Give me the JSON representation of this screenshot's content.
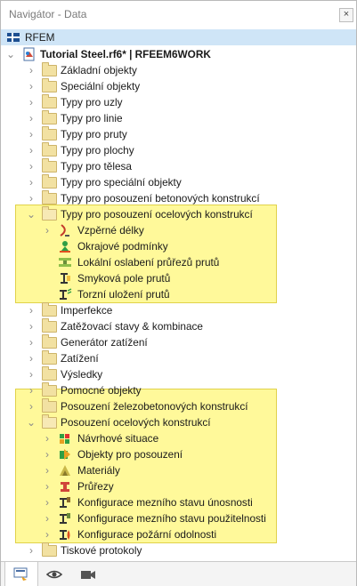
{
  "window": {
    "title": "Navigátor - Data",
    "close_label": "×"
  },
  "tree": {
    "root": "RFEM",
    "project": "Tutorial Steel.rf6* | RFEEM6WORK",
    "items": [
      "Základní objekty",
      "Speciální objekty",
      "Typy pro uzly",
      "Typy pro linie",
      "Typy pro pruty",
      "Typy pro plochy",
      "Typy pro tělesa",
      "Typy pro speciální objekty",
      "Typy pro posouzení betonových konstrukcí"
    ],
    "steel_types": {
      "label": "Typy pro posouzení ocelových konstrukcí",
      "children": [
        "Vzpěrné délky",
        "Okrajové podmínky",
        "Lokální oslabení průřezů prutů",
        "Smyková pole prutů",
        "Torzní uložení prutů"
      ]
    },
    "items2": [
      "Imperfekce",
      "Zatěžovací stavy & kombinace",
      "Generátor zatížení",
      "Zatížení",
      "Výsledky",
      "Pomocné objekty",
      "Posouzení železobetonových konstrukcí"
    ],
    "steel_design": {
      "label": "Posouzení ocelových konstrukcí",
      "children": [
        "Návrhové situace",
        "Objekty pro posouzení",
        "Materiály",
        "Průřezy",
        "Konfigurace mezního stavu únosnosti",
        "Konfigurace mezního stavu použitelnosti",
        "Konfigurace požární odolnosti"
      ]
    },
    "last": "Tiskové protokoly"
  },
  "colors": {
    "highlight": "#fff99a",
    "selection": "#cfe5f7"
  },
  "bottom_tabs": [
    "data-tab-icon",
    "view-eye-icon",
    "camera-icon"
  ]
}
